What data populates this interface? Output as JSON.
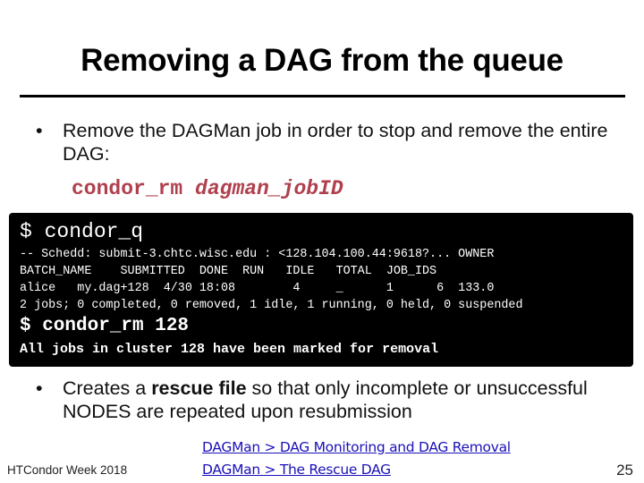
{
  "slide": {
    "title": "Removing a DAG from the queue",
    "bullets": [
      {
        "glyph": "•",
        "text": "Remove the DAGMan job in order to stop and remove the entire DAG:"
      },
      {
        "glyph": "•",
        "text_before": "Creates a ",
        "text_bold": "rescue file",
        "text_after": " so that only incomplete or unsuccessful NODES are repeated upon resubmission"
      }
    ],
    "command": {
      "name": "condor_rm",
      "arg": "dagman_jobID",
      "color": "#b0404e"
    }
  },
  "terminal": {
    "prompt_cmd": "$ condor_q",
    "lines": [
      "-- Schedd: submit-3.chtc.wisc.edu : <128.104.100.44:9618?... OWNER",
      "BATCH_NAME    SUBMITTED  DONE  RUN   IDLE   TOTAL  JOB_IDS",
      "alice   my.dag+128  4/30 18:08        4     _      1      6  133.0",
      "2 jobs; 0 completed, 0 removed, 1 idle, 1 running, 0 held, 0 suspended"
    ],
    "rm_cmd": "$ condor_rm 128",
    "rm_message": "All jobs in cluster 128 have been marked for removal"
  },
  "footer": {
    "event": "HTCondor Week 2018",
    "links": [
      "DAGMan > DAG Monitoring and DAG Removal",
      "DAGMan > The Rescue DAG"
    ],
    "link_color": "#1a10b8",
    "page_number": "25"
  }
}
